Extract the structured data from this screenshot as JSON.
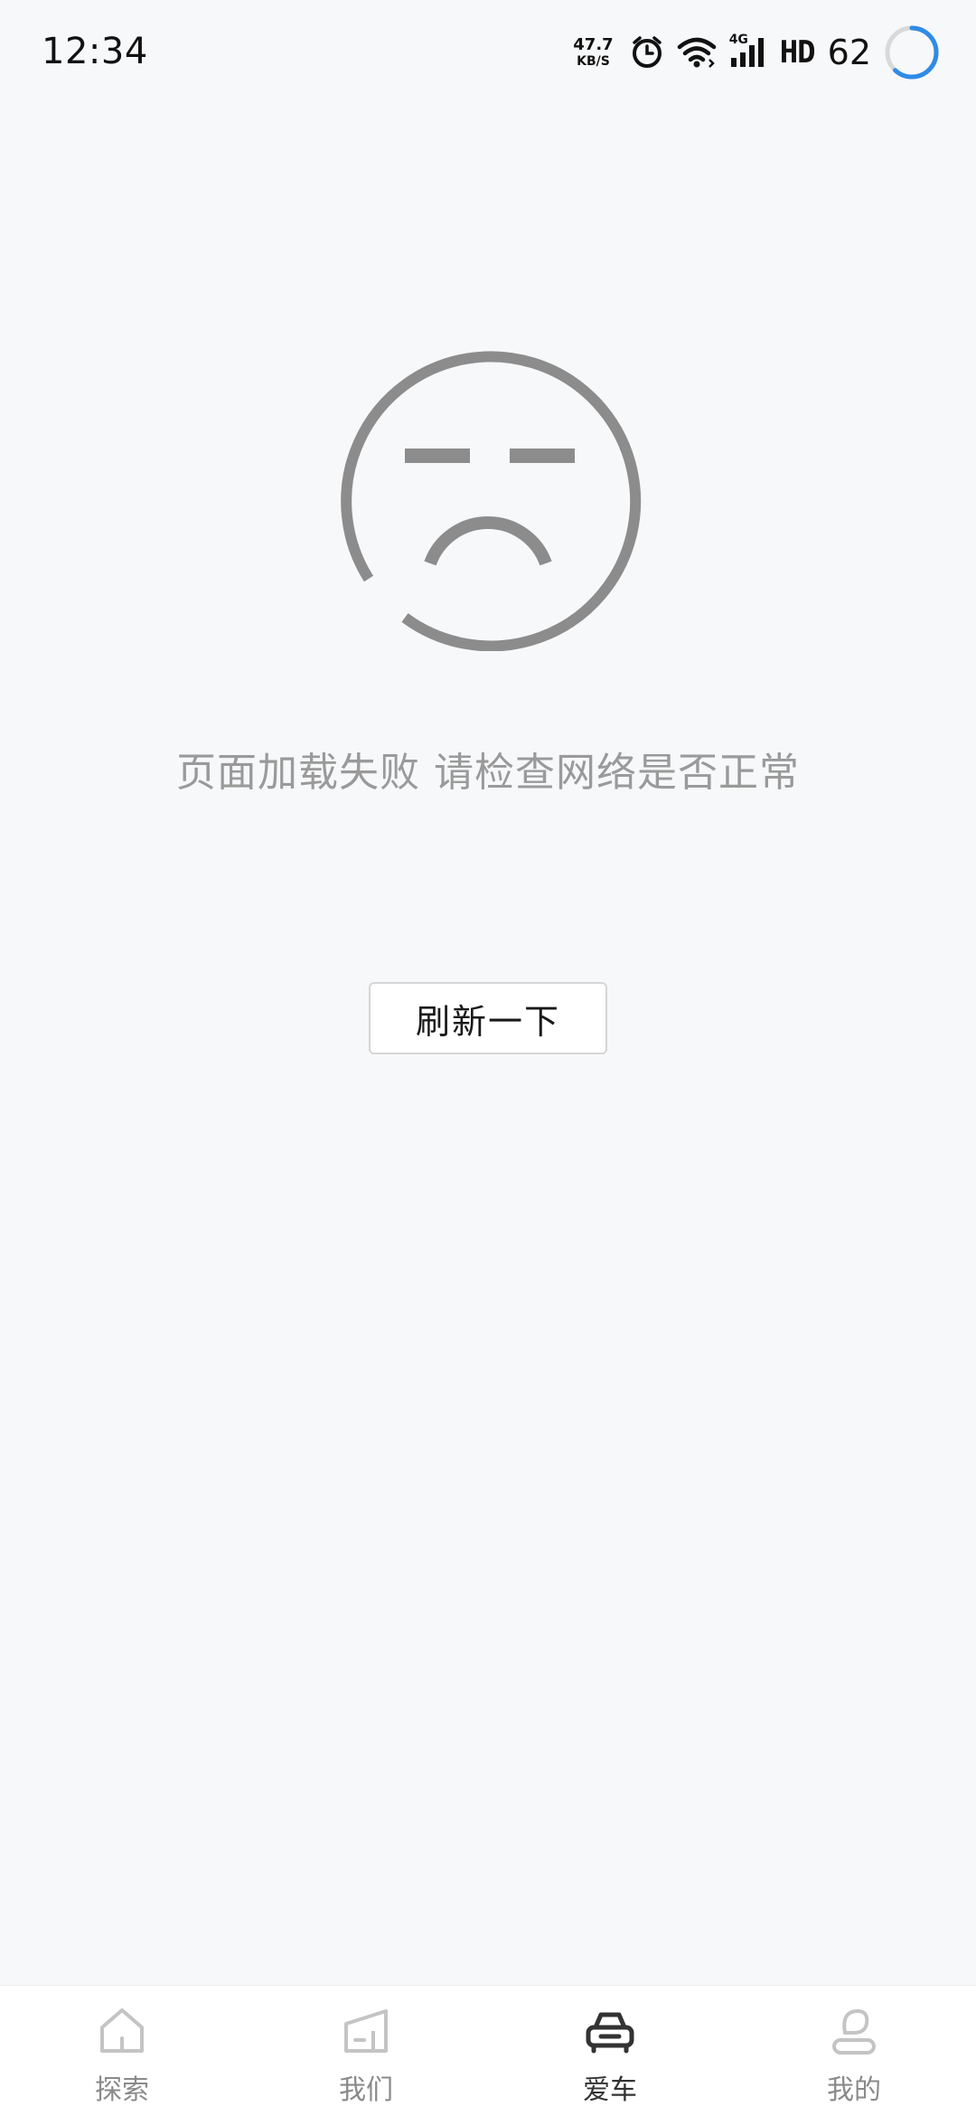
{
  "status_bar": {
    "time": "12:34",
    "net_speed_value": "47.7",
    "net_speed_unit": "KB/S",
    "network_type": "4G",
    "hd_label": "HD",
    "battery_level": "62",
    "icons": [
      "alarm-icon",
      "wifi-icon",
      "cell-signal-icon",
      "battery-ring-icon"
    ]
  },
  "error": {
    "icon": "sad-face-icon",
    "message": "页面加载失败 请检查网络是否正常",
    "refresh_label": "刷新一下"
  },
  "tabs": [
    {
      "label": "探索",
      "icon": "home-icon",
      "active": false
    },
    {
      "label": "我们",
      "icon": "building-icon",
      "active": false
    },
    {
      "label": "爱车",
      "icon": "car-icon",
      "active": true
    },
    {
      "label": "我的",
      "icon": "profile-icon",
      "active": false
    }
  ],
  "colors": {
    "background": "#f7f8fa",
    "icon_gray": "#8c8c8c",
    "tab_inactive": "#c4c4c4",
    "tab_active": "#333333",
    "battery_ring": "#2f8be6"
  }
}
